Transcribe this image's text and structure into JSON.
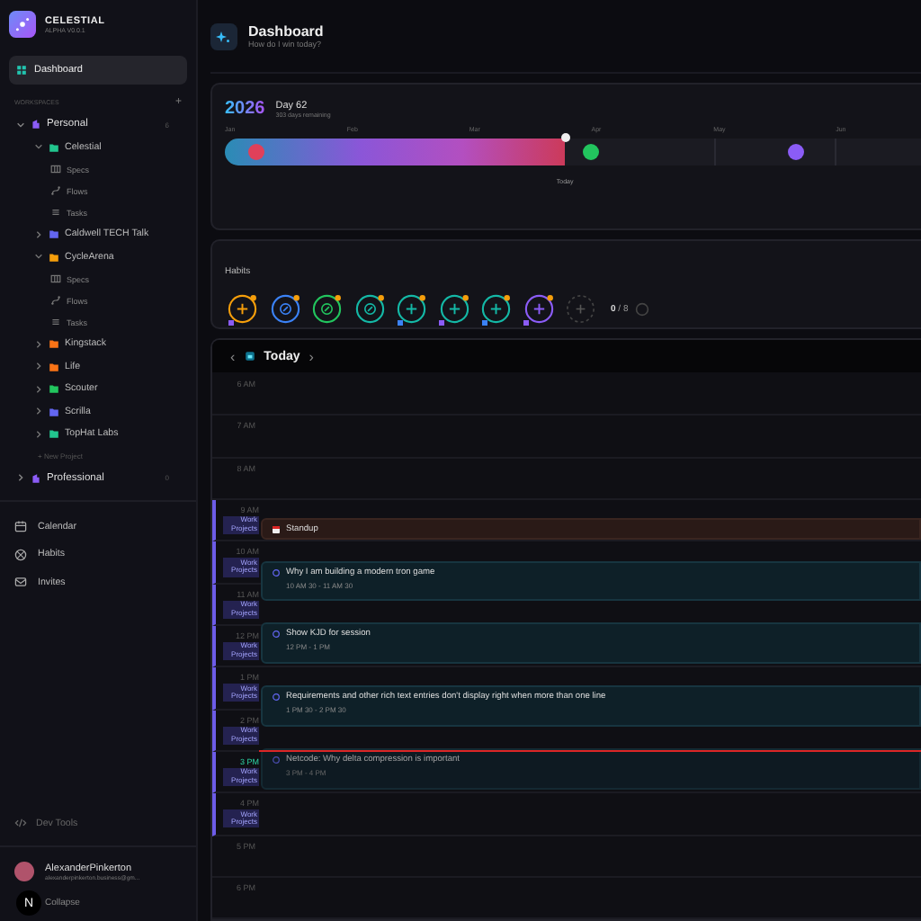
{
  "brand": {
    "name": "CELESTIAL",
    "version": "ALPHA V0.0.1"
  },
  "sidebar": {
    "nav": [
      {
        "label": "Dashboard",
        "selected": true
      }
    ],
    "workspaces_label": "WORKSPACES",
    "add": "+",
    "workspaces": [
      {
        "name": "Personal",
        "count": "6",
        "expanded": true,
        "projects": [
          {
            "name": "Celestial",
            "color": "#22c58e",
            "expanded": true,
            "children": [
              {
                "label": "Specs",
                "kind": "specs"
              },
              {
                "label": "Flows",
                "kind": "flows"
              },
              {
                "label": "Tasks",
                "kind": "tasks"
              }
            ]
          },
          {
            "name": "Caldwell TECH Talk",
            "color": "#6366f1",
            "expanded": false
          },
          {
            "name": "CycleArena",
            "color": "#f59e0b",
            "expanded": true,
            "children": [
              {
                "label": "Specs",
                "kind": "specs"
              },
              {
                "label": "Flows",
                "kind": "flows"
              },
              {
                "label": "Tasks",
                "kind": "tasks"
              }
            ]
          },
          {
            "name": "Kingstack",
            "color": "#f97316",
            "expanded": false
          },
          {
            "name": "Life",
            "color": "#f97316",
            "expanded": false
          },
          {
            "name": "Scouter",
            "color": "#22c55e",
            "expanded": false
          },
          {
            "name": "Scrilla",
            "color": "#6366f1",
            "expanded": false
          },
          {
            "name": "TopHat Labs",
            "color": "#22c58e",
            "expanded": false
          }
        ],
        "new_project": "+ New Project"
      },
      {
        "name": "Professional",
        "count": "0",
        "expanded": false
      }
    ],
    "links": [
      {
        "label": "Calendar",
        "kind": "calendar"
      },
      {
        "label": "Habits",
        "kind": "habits"
      },
      {
        "label": "Invites",
        "kind": "invites"
      }
    ],
    "dev_tools": "Dev Tools",
    "user": {
      "name": "AlexanderPinkerton",
      "email": "alexanderpinkerton.business@gm..."
    },
    "collapse": "Collapse",
    "dev_badge": "N"
  },
  "header": {
    "title": "Dashboard",
    "subtitle": "How do I win today?"
  },
  "year": {
    "year": "2026",
    "day": "Day 62",
    "remaining": "303 days remaining",
    "months": [
      "Jan",
      "Feb",
      "Mar",
      "Apr",
      "May",
      "Jun"
    ],
    "level": 0.232,
    "today_label": "Today",
    "markers": [
      {
        "color": "#e0405a"
      },
      {
        "color": "#22c55e"
      },
      {
        "color": "#8b5cf6"
      }
    ]
  },
  "habits": {
    "title": "Habits",
    "items": [
      {
        "color": "#f59e0b",
        "kind": "plus",
        "tag": {
          "color": "#8b5cf6"
        }
      },
      {
        "color": "#3b82f6",
        "kind": "compass"
      },
      {
        "color": "#22c55e",
        "kind": "compass"
      },
      {
        "color": "#14b8a6",
        "kind": "compass"
      },
      {
        "color": "#14b8a6",
        "kind": "plus",
        "tag": {
          "color": "#3b82f6"
        }
      },
      {
        "color": "#14b8a6",
        "kind": "plus",
        "tag": {
          "color": "#8b5cf6"
        }
      },
      {
        "color": "#14b8a6",
        "kind": "plus",
        "tag": {
          "color": "#3b82f6"
        }
      },
      {
        "color": "#8b5cf6",
        "kind": "plus",
        "tag": {
          "color": "#8b5cf6"
        }
      }
    ],
    "done": "0",
    "slash": "/",
    "total": "8"
  },
  "calendar": {
    "title": "Today",
    "prev": "‹",
    "next": "›",
    "now_line": true,
    "hours": [
      {
        "label": "6 AM",
        "current": false
      },
      {
        "label": "7 AM",
        "current": false
      },
      {
        "label": "8 AM",
        "current": false
      },
      {
        "label": "9 AM",
        "current": false,
        "tag": "Work Projects"
      },
      {
        "label": "10 AM",
        "current": false,
        "tag": "Work Projects"
      },
      {
        "label": "11 AM",
        "current": false,
        "tag": "Work Projects"
      },
      {
        "label": "12 PM",
        "current": false,
        "tag": "Work Projects"
      },
      {
        "label": "1 PM",
        "current": false,
        "tag": "Work Projects"
      },
      {
        "label": "2 PM",
        "current": false,
        "tag": "Work Projects"
      },
      {
        "label": "3 PM",
        "current": true,
        "tag": "Work Projects"
      },
      {
        "label": "4 PM",
        "current": false,
        "tag": "Work Projects"
      },
      {
        "label": "5 PM",
        "current": false
      },
      {
        "label": "6 PM",
        "current": false
      }
    ],
    "events": [
      {
        "kind": "meeting",
        "title": "Standup"
      },
      {
        "kind": "task",
        "title": "Why I am building a modern tron game",
        "time": "10 AM 30 - 11 AM 30",
        "dimmed": false
      },
      {
        "kind": "task",
        "title": "Show KJD for session",
        "time": "12 PM - 1 PM",
        "dimmed": false
      },
      {
        "kind": "task",
        "title": "Requirements and other rich text entries don't display right when more than one line",
        "time": "1 PM 30 - 2 PM 30",
        "dimmed": false
      },
      {
        "kind": "task",
        "title": "Netcode: Why delta compression is important",
        "time": "3 PM - 4 PM",
        "dimmed": true
      }
    ]
  }
}
